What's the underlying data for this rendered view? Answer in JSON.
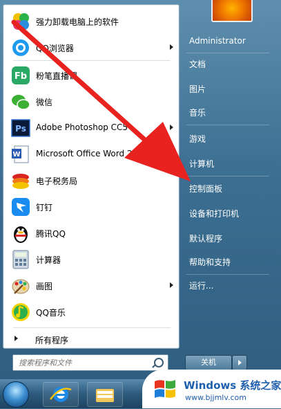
{
  "left_items": [
    {
      "label": "强力卸载电脑上的软件",
      "icon": "pinwheel-app-icon",
      "arrow": false
    },
    {
      "label": "QQ浏览器",
      "icon": "qq-browser-icon",
      "arrow": true
    },
    {
      "label": "粉笔直播课",
      "icon": "fenbi-icon",
      "arrow": false
    },
    {
      "label": "微信",
      "icon": "wechat-icon",
      "arrow": false
    },
    {
      "label": "Adobe Photoshop CC5",
      "icon": "photoshop-icon",
      "arrow": true
    },
    {
      "label": "Microsoft Office Word 2007",
      "icon": "word-icon",
      "arrow": true
    },
    {
      "label": "电子税务局",
      "icon": "tax-bureau-icon",
      "arrow": false
    },
    {
      "label": "钉钉",
      "icon": "dingtalk-icon",
      "arrow": false
    },
    {
      "label": "腾讯QQ",
      "icon": "qq-penguin-icon",
      "arrow": false
    },
    {
      "label": "计算器",
      "icon": "calculator-icon",
      "arrow": false
    },
    {
      "label": "画图",
      "icon": "paint-icon",
      "arrow": true
    },
    {
      "label": "QQ音乐",
      "icon": "qq-music-icon",
      "arrow": false
    }
  ],
  "all_programs": "所有程序",
  "search": {
    "placeholder": "搜索程序和文件"
  },
  "right_items": [
    {
      "label": "Administrator"
    },
    {
      "label": "文档"
    },
    {
      "label": "图片"
    },
    {
      "label": "音乐"
    },
    {
      "label": "游戏"
    },
    {
      "label": "计算机"
    },
    {
      "label": "控制面板"
    },
    {
      "label": "设备和打印机"
    },
    {
      "label": "默认程序"
    },
    {
      "label": "帮助和支持"
    },
    {
      "label": "运行..."
    }
  ],
  "shutdown": {
    "label": "关机"
  },
  "watermark": {
    "title": "Windows 系统之家",
    "url": "www.bjjmlv.com"
  },
  "colors": {
    "annotation_arrow": "#e8231f",
    "watermark_text": "#1e5fae"
  }
}
